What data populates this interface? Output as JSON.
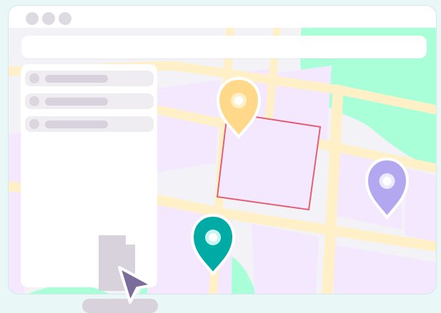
{
  "window": {
    "controls": [
      "close",
      "minimize",
      "maximize"
    ]
  },
  "address_bar": {
    "value": "",
    "placeholder": ""
  },
  "sidebar": {
    "items": [
      {
        "label": ""
      },
      {
        "label": ""
      },
      {
        "label": ""
      }
    ]
  },
  "map": {
    "selection_box": "red outline",
    "pins": [
      {
        "color": "#ffd88a",
        "icon": "location-pin-icon"
      },
      {
        "color": "#b3a8f0",
        "icon": "location-pin-icon"
      },
      {
        "color": "#00aba5",
        "icon": "location-pin-icon"
      }
    ]
  },
  "icons": {
    "document": "document-icon",
    "cursor": "cursor-icon"
  },
  "colors": {
    "background": "#e9f7f6",
    "window": "#f3f2f7",
    "road": "#fff0c7",
    "block": "#f4e8ff",
    "park": "#a8ffd8",
    "selection": "#e25f74",
    "cursor": "#7b6c9b"
  }
}
